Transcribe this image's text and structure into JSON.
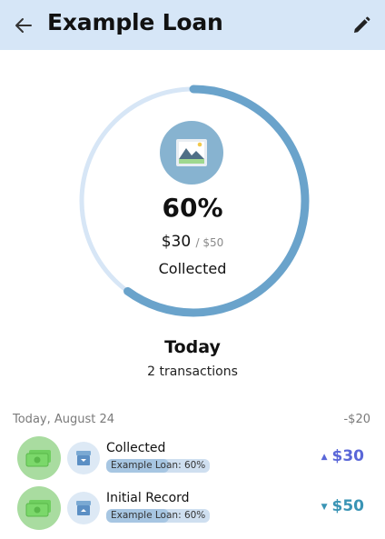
{
  "header": {
    "title": "Example Loan",
    "back_icon": "arrow-left-icon",
    "edit_icon": "pencil-icon",
    "background": "#d6e6f7"
  },
  "summary": {
    "progress": 0.6,
    "percent_label": "60%",
    "collected_amount": "$30",
    "total_amount": "/ $50",
    "status_label": "Collected",
    "ring_color": "#6aa3cb",
    "ring_track_color": "#d7e6f6",
    "image_icon": "image-placeholder-icon"
  },
  "today": {
    "title": "Today",
    "subtitle": "2 transactions"
  },
  "group": {
    "date_label": "Today, August 24",
    "total_label": "-$20"
  },
  "transactions": [
    {
      "title": "Collected",
      "tag": "Example Loan: 60%",
      "tag_progress": 0.6,
      "amount": "$30",
      "direction": "up",
      "amount_color": "#5a67d8",
      "icon": "cash-icon",
      "type_icon": "archive-in-icon"
    },
    {
      "title": "Initial Record",
      "tag": "Example Loan: 60%",
      "tag_progress": 0.6,
      "amount": "$50",
      "direction": "down",
      "amount_color": "#3a94b5",
      "icon": "cash-icon",
      "type_icon": "archive-out-icon"
    }
  ]
}
